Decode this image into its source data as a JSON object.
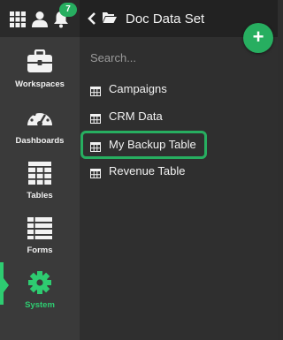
{
  "rail": {
    "notification_count": "7",
    "nav": [
      {
        "id": "workspaces",
        "label": "Workspaces",
        "icon": "briefcase-icon"
      },
      {
        "id": "dashboards",
        "label": "Dashboards",
        "icon": "gauge-icon"
      },
      {
        "id": "tables",
        "label": "Tables",
        "icon": "table-grid-icon"
      },
      {
        "id": "forms",
        "label": "Forms",
        "icon": "list-icon"
      },
      {
        "id": "system",
        "label": "System",
        "icon": "gear-icon",
        "active": true
      }
    ]
  },
  "panel": {
    "title": "Doc Data Set",
    "search_placeholder": "Search...",
    "add_label": "+",
    "items": [
      {
        "label": "Campaigns"
      },
      {
        "label": "CRM Data"
      },
      {
        "label": "My Backup Table",
        "selected": true
      },
      {
        "label": "Revenue Table"
      }
    ]
  },
  "colors": {
    "accent": "#27ae60",
    "accent_light": "#2ecc71",
    "rail_bg": "#3a3a3a",
    "panel_bg": "#2f2f2f",
    "header_bg": "#222222"
  }
}
